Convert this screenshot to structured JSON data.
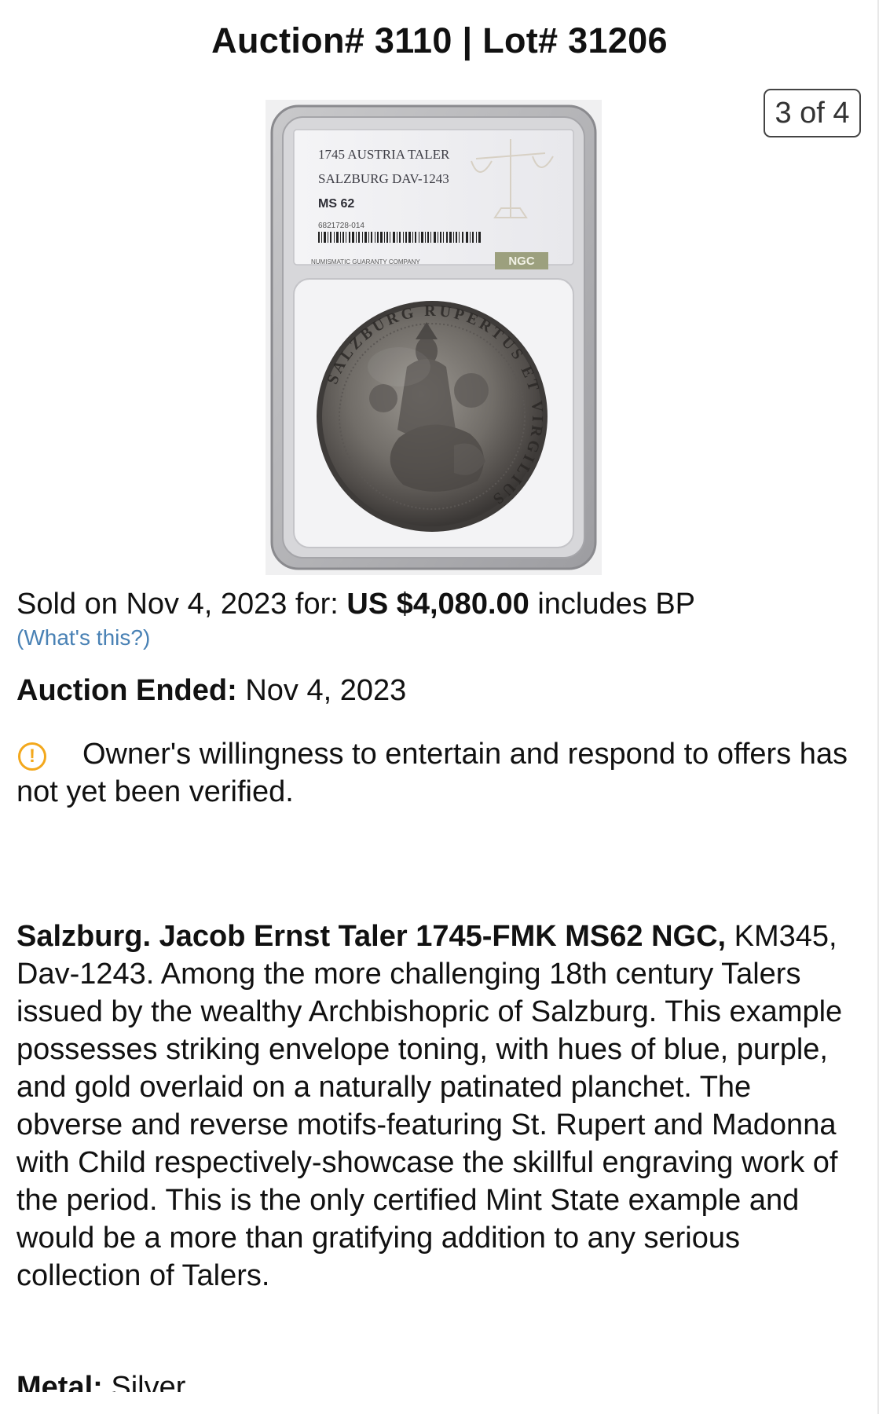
{
  "header": {
    "title": "Auction# 3110 | Lot# 31206"
  },
  "gallery": {
    "pager": "3 of 4",
    "label_lines": [
      "1745 AUSTRIA TALER",
      "SALZBURG DAV-1243",
      "MS 62",
      "6821728-014"
    ],
    "company_line": "NUMISMATIC GUARANTY COMPANY",
    "logo_text": "NGC",
    "coin_legend": "SALZBURG RUPERTUS ET VIRGILIUS"
  },
  "sale": {
    "sold_prefix": "Sold on Nov 4, 2023 for: ",
    "price": "US $4,080.00",
    "sold_suffix": " includes BP",
    "whats_this": "(What's this?)"
  },
  "auction_ended": {
    "label": "Auction Ended:",
    "value": " Nov 4, 2023"
  },
  "notice": {
    "icon": "warning-circle-icon",
    "icon_glyph": "!",
    "text": "Owner's willingness to entertain and respond to offers has not yet been verified."
  },
  "description": {
    "heading": "Salzburg. Jacob Ernst Taler 1745-FMK MS62 NGC,",
    "body": " KM345, Dav-1243. Among the more challenging 18th century Talers issued by the wealthy Archbishopric of Salzburg. This example possesses striking envelope toning, with hues of blue, purple, and gold overlaid on a naturally patinated planchet. The obverse and reverse motifs-featuring St. Rupert and Madonna with Child respectively-showcase the skillful engraving work of the period. This is the only certified Mint State example and would be a more than gratifying addition to any serious collection of Talers."
  },
  "metal": {
    "label": "Metal:",
    "value": " Silver"
  },
  "colors": {
    "link": "#4a82b5",
    "warning": "#f3a81c"
  }
}
